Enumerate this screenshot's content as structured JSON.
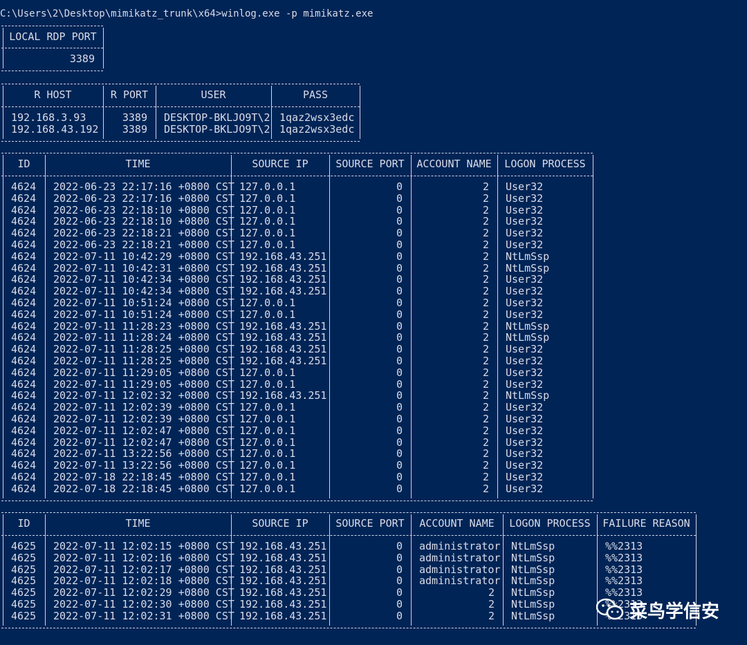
{
  "command": "C:\\Users\\2\\Desktop\\mimikatz_trunk\\x64>winlog.exe -p mimikatz.exe",
  "rdp_port": {
    "header": "LOCAL RDP PORT",
    "value": "3389"
  },
  "hosts": {
    "headers": [
      "R HOST",
      "R PORT",
      "USER",
      "PASS"
    ],
    "rows": [
      [
        "192.168.3.93",
        "3389",
        "DESKTOP-BKLJO9T\\2",
        "1qaz2wsx3edc"
      ],
      [
        "192.168.43.192",
        "3389",
        "DESKTOP-BKLJO9T\\2",
        "1qaz2wsx3edc"
      ]
    ]
  },
  "logons": {
    "headers": [
      "ID",
      "TIME",
      "SOURCE IP",
      "SOURCE PORT",
      "ACCOUNT NAME",
      "LOGON PROCESS"
    ],
    "rows": [
      [
        "4624",
        "2022-06-23 22:17:16 +0800 CST",
        "127.0.0.1",
        "0",
        "2",
        "User32"
      ],
      [
        "4624",
        "2022-06-23 22:17:16 +0800 CST",
        "127.0.0.1",
        "0",
        "2",
        "User32"
      ],
      [
        "4624",
        "2022-06-23 22:18:10 +0800 CST",
        "127.0.0.1",
        "0",
        "2",
        "User32"
      ],
      [
        "4624",
        "2022-06-23 22:18:10 +0800 CST",
        "127.0.0.1",
        "0",
        "2",
        "User32"
      ],
      [
        "4624",
        "2022-06-23 22:18:21 +0800 CST",
        "127.0.0.1",
        "0",
        "2",
        "User32"
      ],
      [
        "4624",
        "2022-06-23 22:18:21 +0800 CST",
        "127.0.0.1",
        "0",
        "2",
        "User32"
      ],
      [
        "4624",
        "2022-07-11 10:42:29 +0800 CST",
        "192.168.43.251",
        "0",
        "2",
        "NtLmSsp"
      ],
      [
        "4624",
        "2022-07-11 10:42:31 +0800 CST",
        "192.168.43.251",
        "0",
        "2",
        "NtLmSsp"
      ],
      [
        "4624",
        "2022-07-11 10:42:34 +0800 CST",
        "192.168.43.251",
        "0",
        "2",
        "User32"
      ],
      [
        "4624",
        "2022-07-11 10:42:34 +0800 CST",
        "192.168.43.251",
        "0",
        "2",
        "User32"
      ],
      [
        "4624",
        "2022-07-11 10:51:24 +0800 CST",
        "127.0.0.1",
        "0",
        "2",
        "User32"
      ],
      [
        "4624",
        "2022-07-11 10:51:24 +0800 CST",
        "127.0.0.1",
        "0",
        "2",
        "User32"
      ],
      [
        "4624",
        "2022-07-11 11:28:23 +0800 CST",
        "192.168.43.251",
        "0",
        "2",
        "NtLmSsp"
      ],
      [
        "4624",
        "2022-07-11 11:28:24 +0800 CST",
        "192.168.43.251",
        "0",
        "2",
        "NtLmSsp"
      ],
      [
        "4624",
        "2022-07-11 11:28:25 +0800 CST",
        "192.168.43.251",
        "0",
        "2",
        "User32"
      ],
      [
        "4624",
        "2022-07-11 11:28:25 +0800 CST",
        "192.168.43.251",
        "0",
        "2",
        "User32"
      ],
      [
        "4624",
        "2022-07-11 11:29:05 +0800 CST",
        "127.0.0.1",
        "0",
        "2",
        "User32"
      ],
      [
        "4624",
        "2022-07-11 11:29:05 +0800 CST",
        "127.0.0.1",
        "0",
        "2",
        "User32"
      ],
      [
        "4624",
        "2022-07-11 12:02:32 +0800 CST",
        "192.168.43.251",
        "0",
        "2",
        "NtLmSsp"
      ],
      [
        "4624",
        "2022-07-11 12:02:39 +0800 CST",
        "127.0.0.1",
        "0",
        "2",
        "User32"
      ],
      [
        "4624",
        "2022-07-11 12:02:39 +0800 CST",
        "127.0.0.1",
        "0",
        "2",
        "User32"
      ],
      [
        "4624",
        "2022-07-11 12:02:47 +0800 CST",
        "127.0.0.1",
        "0",
        "2",
        "User32"
      ],
      [
        "4624",
        "2022-07-11 12:02:47 +0800 CST",
        "127.0.0.1",
        "0",
        "2",
        "User32"
      ],
      [
        "4624",
        "2022-07-11 13:22:56 +0800 CST",
        "127.0.0.1",
        "0",
        "2",
        "User32"
      ],
      [
        "4624",
        "2022-07-11 13:22:56 +0800 CST",
        "127.0.0.1",
        "0",
        "2",
        "User32"
      ],
      [
        "4624",
        "2022-07-18 22:18:45 +0800 CST",
        "127.0.0.1",
        "0",
        "2",
        "User32"
      ],
      [
        "4624",
        "2022-07-18 22:18:45 +0800 CST",
        "127.0.0.1",
        "0",
        "2",
        "User32"
      ]
    ]
  },
  "failures": {
    "headers": [
      "ID",
      "TIME",
      "SOURCE IP",
      "SOURCE PORT",
      "ACCOUNT NAME",
      "LOGON PROCESS",
      "FAILURE REASON"
    ],
    "rows": [
      [
        "4625",
        "2022-07-11 12:02:15 +0800 CST",
        "192.168.43.251",
        "0",
        "administrator",
        "NtLmSsp",
        "%%2313"
      ],
      [
        "4625",
        "2022-07-11 12:02:16 +0800 CST",
        "192.168.43.251",
        "0",
        "administrator",
        "NtLmSsp",
        "%%2313"
      ],
      [
        "4625",
        "2022-07-11 12:02:17 +0800 CST",
        "192.168.43.251",
        "0",
        "administrator",
        "NtLmSsp",
        "%%2313"
      ],
      [
        "4625",
        "2022-07-11 12:02:18 +0800 CST",
        "192.168.43.251",
        "0",
        "administrator",
        "NtLmSsp",
        "%%2313"
      ],
      [
        "4625",
        "2022-07-11 12:02:29 +0800 CST",
        "192.168.43.251",
        "0",
        "2",
        "NtLmSsp",
        "%%2313"
      ],
      [
        "4625",
        "2022-07-11 12:02:30 +0800 CST",
        "192.168.43.251",
        "0",
        "2",
        "NtLmSsp",
        "%%2313"
      ],
      [
        "4625",
        "2022-07-11 12:02:31 +0800 CST",
        "192.168.43.251",
        "0",
        "2",
        "NtLmSsp",
        "%%2313"
      ]
    ]
  },
  "watermark": {
    "text": "菜鸟学信安",
    "icon": "wechat-icon"
  },
  "colors": {
    "background": "#012456",
    "text": "#d8dce8"
  }
}
